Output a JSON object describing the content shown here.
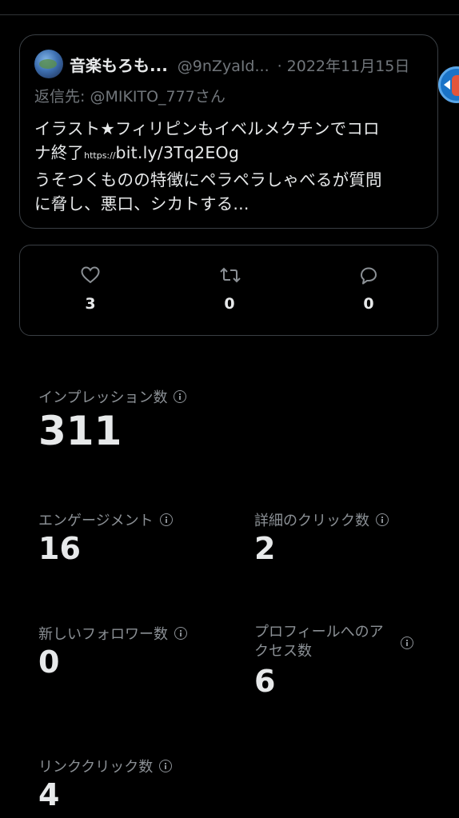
{
  "tweet": {
    "author_name": "音楽もろも...",
    "author_handle": "@9nZyaId...",
    "separator": "·",
    "date": "2022年11月15日",
    "reply_to": "返信先: @MIKITO_777さん",
    "text_line1": "イラスト★フィリピンもイベルメクチンでコロ",
    "text_line2_prefix": "ナ終了",
    "text_line2_link_prefix": "https://",
    "text_line2_link": "bit.ly/3Tq2EOg",
    "text_line3": "うそつくものの特徴にペラペラしゃべるが質問",
    "text_line4": "に脅し、悪口、シカトする..."
  },
  "engagement_bar": {
    "likes": "3",
    "retweets": "0",
    "replies": "0",
    "like_icon": "heart-icon",
    "retweet_icon": "retweet-icon",
    "reply_icon": "reply-icon"
  },
  "stats": {
    "impressions_label": "インプレッション数",
    "impressions_value": "311",
    "engagements_label": "エンゲージメント",
    "engagements_value": "16",
    "detail_clicks_label": "詳細のクリック数",
    "detail_clicks_value": "2",
    "new_followers_label": "新しいフォロワー数",
    "new_followers_value": "0",
    "profile_visits_label_line1": "プロフィールへのア",
    "profile_visits_label_line2": "クセス数",
    "profile_visits_value": "6",
    "link_clicks_label": "リンククリック数",
    "link_clicks_value": "4"
  },
  "colors": {
    "background": "#000000",
    "text_primary": "#e7e9ea",
    "text_secondary": "#71767b",
    "border": "#3a3f44"
  }
}
